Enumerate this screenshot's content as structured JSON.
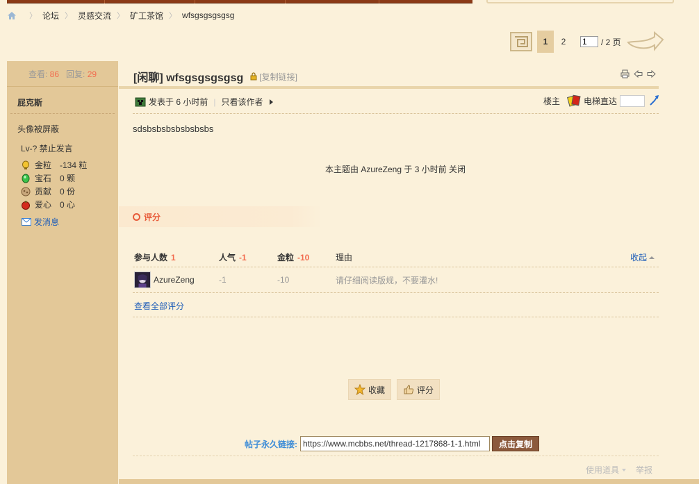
{
  "breadcrumb": {
    "items": [
      "论坛",
      "灵感交流",
      "矿工茶馆"
    ],
    "current": "wfsgsgsgsgsg"
  },
  "pagination": {
    "pages": [
      "1",
      "2"
    ],
    "active": "1",
    "input_value": "1",
    "total_label": "/ 2 页"
  },
  "author": {
    "stats": {
      "views_label": "查看:",
      "views": "86",
      "replies_label": "回复:",
      "replies": "29"
    },
    "name": "屁克斯",
    "avatar_hidden": "头像被屏蔽",
    "level": "Lv-? 禁止发言",
    "attributes": [
      {
        "icon": "gold-nugget-icon",
        "label": "金粒",
        "value": "-134 粒"
      },
      {
        "icon": "emerald-icon",
        "label": "宝石",
        "value": "0 颗"
      },
      {
        "icon": "contribution-icon",
        "label": "贡献",
        "value": "0 份"
      },
      {
        "icon": "apple-heart-icon",
        "label": "爱心",
        "value": "0 心"
      }
    ],
    "send_message": "发消息"
  },
  "thread": {
    "title": "[闲聊] wfsgsgsgsgsg",
    "copy_link": "[复制链接]"
  },
  "post": {
    "posted": "发表于 6 小时前",
    "only_author": "只看该作者",
    "floor_label": "楼主",
    "elevator_label": "电梯直达",
    "body": "sdsbsbsbsbsbsbsbs",
    "closed_note": "本主题由 AzureZeng 于 3 小时前 关闭"
  },
  "rating": {
    "header": "评分",
    "columns": {
      "participants": "参与人数",
      "participants_count": "1",
      "popularity": "人气",
      "popularity_total": "-1",
      "gold": "金粒",
      "gold_total": "-10",
      "reason": "理由",
      "collapse": "收起"
    },
    "rows": [
      {
        "user": "AzureZeng",
        "popularity": "-1",
        "gold": "-10",
        "reason": "请仔细阅读版规，不要灌水!"
      }
    ],
    "view_all": "查看全部评分"
  },
  "actions": {
    "favorite": "收藏",
    "rate": "评分"
  },
  "permalink": {
    "label": "帖子永久链接:",
    "url": "https://www.mcbbs.net/thread-1217868-1-1.html",
    "copy_button": "点击复制"
  },
  "footer": {
    "use_tool": "使用道具",
    "report": "举报"
  },
  "colors": {
    "accent_red": "#f26c4f",
    "link_blue": "#1e5db8",
    "sidebar_bg": "#e3c898",
    "page_bg": "#fbf1da",
    "copy_button_bg": "#8c5a3c"
  }
}
